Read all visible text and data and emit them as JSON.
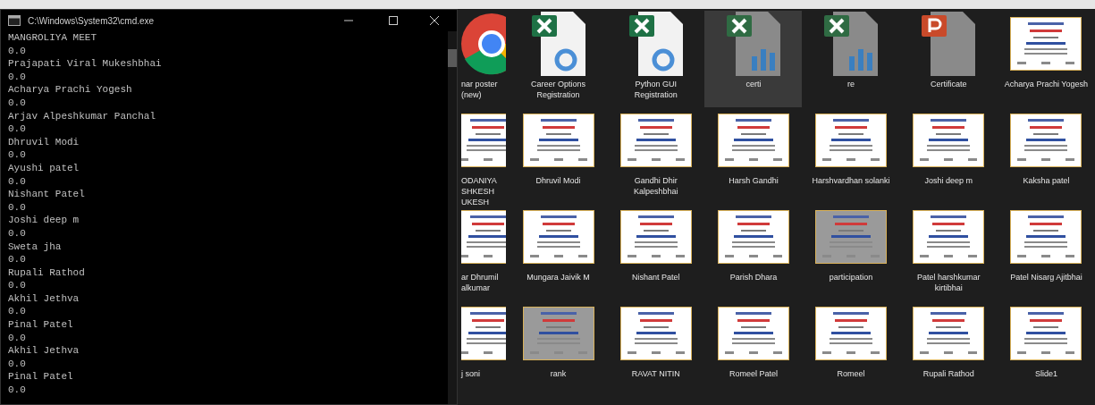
{
  "console": {
    "title": "C:\\Windows\\System32\\cmd.exe",
    "lines": [
      "MANGROLIYA MEET",
      "0.0",
      "Prajapati Viral Mukeshbhai",
      "0.0",
      "Acharya Prachi Yogesh",
      "0.0",
      "Arjav Alpeshkumar Panchal",
      "0.0",
      "Dhruvil Modi",
      "0.0",
      "Ayushi patel",
      "0.0",
      "Nishant Patel",
      "0.0",
      "Joshi deep m",
      "0.0",
      "Sweta jha",
      "0.0",
      "Rupali Rathod",
      "0.0",
      "Akhil Jethva",
      "0.0",
      "Pinal Patel",
      "0.0",
      "Akhil Jethva",
      "0.0",
      "Pinal Patel",
      "0.0"
    ]
  },
  "files": [
    {
      "label": "nar poster (new)",
      "kind": "chrome",
      "selected": false
    },
    {
      "label": "Career Options Registration",
      "kind": "excel",
      "selected": false
    },
    {
      "label": "Python GUI Registration",
      "kind": "excel",
      "selected": false
    },
    {
      "label": "certi",
      "kind": "excel-chart",
      "selected": true
    },
    {
      "label": "re",
      "kind": "excel-chart",
      "selected": false
    },
    {
      "label": "Certificate",
      "kind": "powerpoint",
      "selected": false
    },
    {
      "label": "Acharya Prachi Yogesh",
      "kind": "certificate",
      "selected": false
    },
    {
      "label": "ODANIYA SHKESH UKESH",
      "kind": "certificate",
      "selected": false
    },
    {
      "label": "Dhruvil Modi",
      "kind": "certificate",
      "selected": false
    },
    {
      "label": "Gandhi Dhir Kalpeshbhai",
      "kind": "certificate",
      "selected": false
    },
    {
      "label": "Harsh Gandhi",
      "kind": "certificate",
      "selected": false
    },
    {
      "label": "Harshvardhan solanki",
      "kind": "certificate",
      "selected": false
    },
    {
      "label": "Joshi deep m",
      "kind": "certificate",
      "selected": false
    },
    {
      "label": "Kaksha patel",
      "kind": "certificate",
      "selected": false
    },
    {
      "label": "ar Dhrumil alkumar",
      "kind": "certificate",
      "selected": false
    },
    {
      "label": "Mungara Jaivik M",
      "kind": "certificate",
      "selected": false
    },
    {
      "label": "Nishant Patel",
      "kind": "certificate",
      "selected": false
    },
    {
      "label": "Parish Dhara",
      "kind": "certificate",
      "selected": false
    },
    {
      "label": "participation",
      "kind": "certificate-gray",
      "selected": false
    },
    {
      "label": "Patel harshkumar kirtibhai",
      "kind": "certificate",
      "selected": false
    },
    {
      "label": "Patel Nisarg Ajitbhai",
      "kind": "certificate",
      "selected": false
    },
    {
      "label": "j soni",
      "kind": "certificate",
      "selected": false
    },
    {
      "label": "rank",
      "kind": "certificate-gray",
      "selected": false
    },
    {
      "label": "RAVAT NITIN",
      "kind": "certificate",
      "selected": false
    },
    {
      "label": "Romeel Patel",
      "kind": "certificate",
      "selected": false
    },
    {
      "label": "Romeel",
      "kind": "certificate",
      "selected": false
    },
    {
      "label": "Rupali Rathod",
      "kind": "certificate",
      "selected": false
    },
    {
      "label": "Slide1",
      "kind": "certificate",
      "selected": false
    }
  ]
}
